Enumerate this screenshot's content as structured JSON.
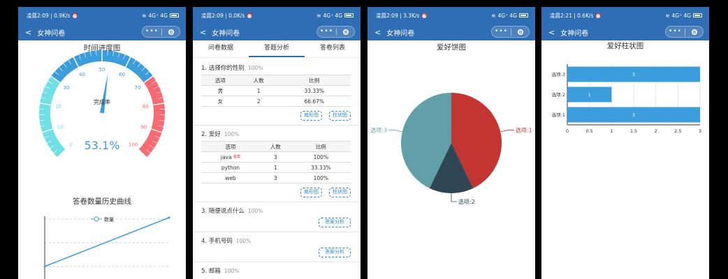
{
  "screens": [
    {
      "status": {
        "time": "凌晨2:09",
        "speed": "0.9K/s",
        "net": "4G⁺ 4G"
      },
      "nav_title": "女神问卷"
    },
    {
      "status": {
        "time": "凌晨2:09",
        "speed": "0.0K/s",
        "net": "4G⁺ 4G"
      },
      "nav_title": "女神问卷"
    },
    {
      "status": {
        "time": "凌晨2:09",
        "speed": "3.3K/s",
        "net": "4G⁺ 4G"
      },
      "nav_title": "女神问卷"
    },
    {
      "status": {
        "time": "凌晨2:21",
        "speed": "0.6K/s",
        "net": "4G⁺ 4G"
      },
      "nav_title": "女神问卷"
    }
  ],
  "capsule": {
    "dots": "•••"
  },
  "gauge": {
    "title": "时间进度图",
    "center_label": "完成率",
    "value_text": "53.1%",
    "value": 53.1,
    "ticks": [
      "0",
      "10",
      "20",
      "30",
      "40",
      "50",
      "60",
      "70",
      "80",
      "90",
      "100"
    ],
    "colors": {
      "low": "#6ee0e6",
      "mid": "#3c9ddc",
      "high": "#f96b72"
    }
  },
  "history_chart": {
    "title": "答卷数量历史曲线",
    "legend": "数量",
    "color": "#3c9ddc"
  },
  "analysis": {
    "tabs": [
      "问卷数据",
      "答题分析",
      "答卷列表"
    ],
    "active_tab": 1,
    "questions": [
      {
        "num": "1.",
        "text": "选择你的性别",
        "pct": "100%",
        "headers": [
          "选项",
          "人数",
          "比例"
        ],
        "rows": [
          [
            "男",
            "1",
            "33.33%"
          ],
          [
            "女",
            "2",
            "66.67%"
          ]
        ],
        "buttons": [
          "扇形图",
          "柱状图"
        ]
      },
      {
        "num": "2.",
        "text": "爱好",
        "pct": "100%",
        "headers": [
          "选项",
          "人数",
          "比例"
        ],
        "rows": [
          [
            "java",
            "3",
            "100%"
          ],
          [
            "python",
            "1",
            "33.33%"
          ],
          [
            "web",
            "3",
            "100%"
          ]
        ],
        "answer_mark": "答案",
        "buttons": [
          "扇形图",
          "柱状图"
        ]
      },
      {
        "num": "3.",
        "text": "随便说点什么",
        "pct": "100%",
        "button": "答案分析"
      },
      {
        "num": "4.",
        "text": "手机号码",
        "pct": "100%",
        "button": "答案分析"
      },
      {
        "num": "5.",
        "text": "邮箱",
        "pct": "100%"
      }
    ]
  },
  "chart_data": [
    {
      "type": "pie",
      "title": "爱好饼图",
      "labels": [
        "选项:1",
        "选项:2",
        "选项:3"
      ],
      "values": [
        3,
        1,
        3
      ],
      "colors": [
        "#c23531",
        "#2f4554",
        "#61a0a8"
      ]
    },
    {
      "type": "bar",
      "orientation": "horizontal",
      "title": "爱好柱状图",
      "categories": [
        "选项:1",
        "选项:2",
        "选项:3"
      ],
      "values": [
        3,
        1,
        3
      ],
      "xlim": [
        0,
        3
      ],
      "xticks": [
        "0",
        "0.5",
        "1",
        "1.5",
        "2",
        "2.5",
        "3"
      ],
      "color": "#3c9ddc"
    }
  ]
}
